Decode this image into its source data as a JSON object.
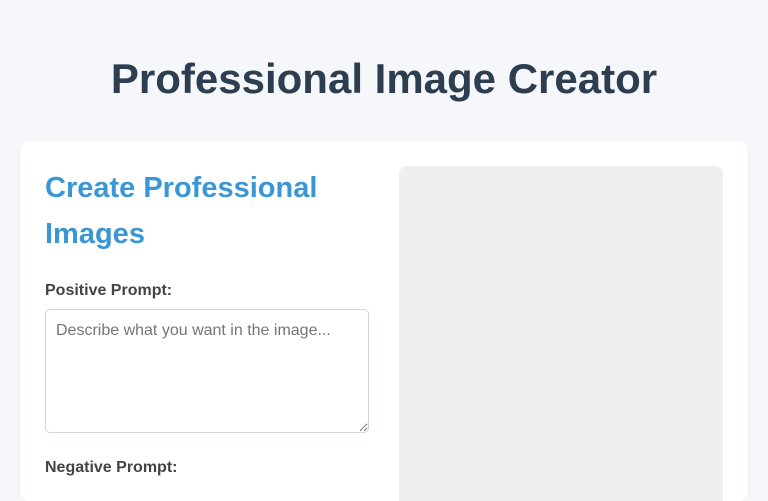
{
  "header": {
    "title": "Professional Image Creator"
  },
  "form": {
    "heading": "Create Professional Images",
    "positive_label": "Positive Prompt:",
    "positive_placeholder": "Describe what you want in the image...",
    "positive_value": "",
    "negative_label": "Negative Prompt:"
  },
  "colors": {
    "page_background": "#f5f7fa",
    "title": "#2c3e50",
    "accent": "#3a97d4",
    "preview_background": "#efefef"
  }
}
